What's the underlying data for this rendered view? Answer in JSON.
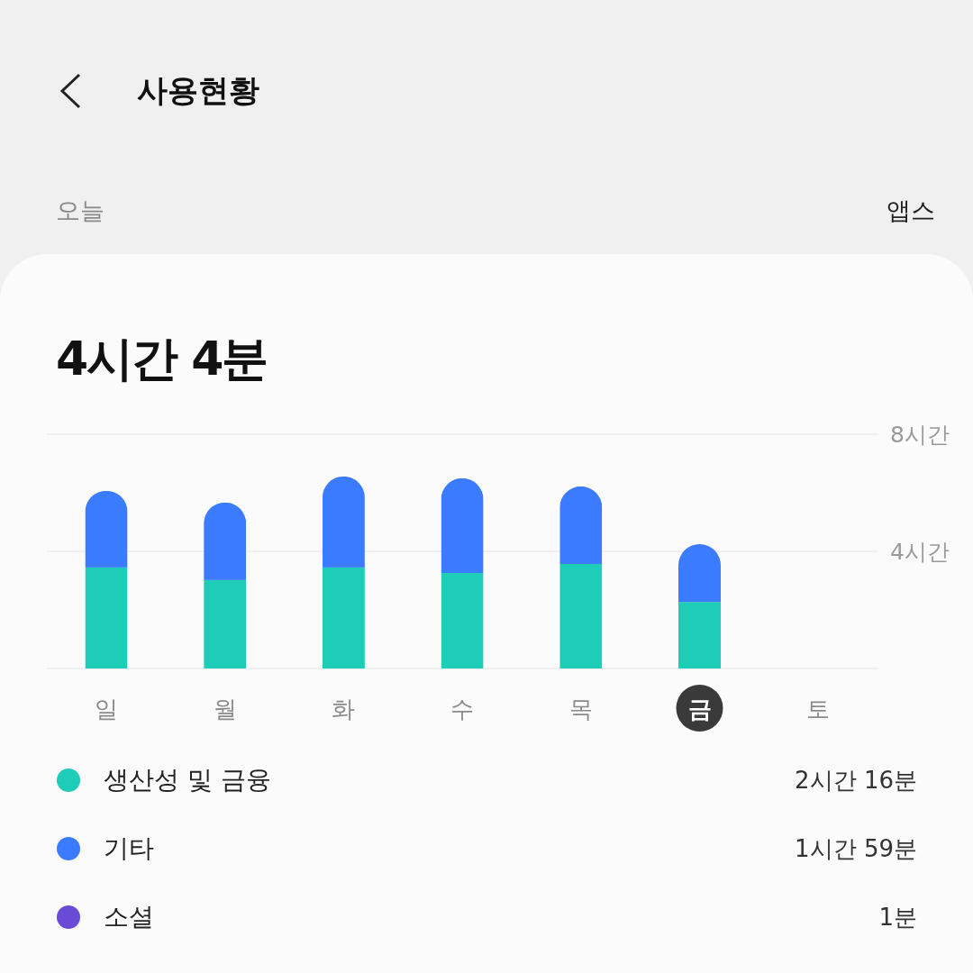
{
  "header": {
    "title": "사용현황",
    "period": "오늘",
    "view": "앱스"
  },
  "total": "4시간 4분",
  "chart_data": {
    "type": "bar",
    "stacked": true,
    "categories": [
      "일",
      "월",
      "화",
      "수",
      "목",
      "금",
      "토"
    ],
    "series": [
      {
        "name": "생산성 및 금융",
        "color": "#1ecdb7",
        "values": [
          3.45,
          3.02,
          3.45,
          3.26,
          3.57,
          2.27,
          null
        ]
      },
      {
        "name": "기타",
        "color": "#3a7bff",
        "values": [
          2.62,
          2.65,
          3.11,
          3.24,
          2.65,
          1.98,
          null
        ]
      },
      {
        "name": "소셜",
        "color": "#6a4bd6",
        "values": [
          null,
          null,
          null,
          null,
          null,
          null,
          null
        ]
      }
    ],
    "ylim": [
      0,
      8
    ],
    "yticks": [
      {
        "value": 4,
        "label": "4시간"
      },
      {
        "value": 8,
        "label": "8시간"
      }
    ]
  },
  "day_selected": [
    false,
    false,
    false,
    false,
    false,
    true,
    false
  ],
  "legend": [
    {
      "time": "2시간 16분"
    },
    {
      "time": "1시간 59분"
    },
    {
      "time": "1분"
    }
  ]
}
